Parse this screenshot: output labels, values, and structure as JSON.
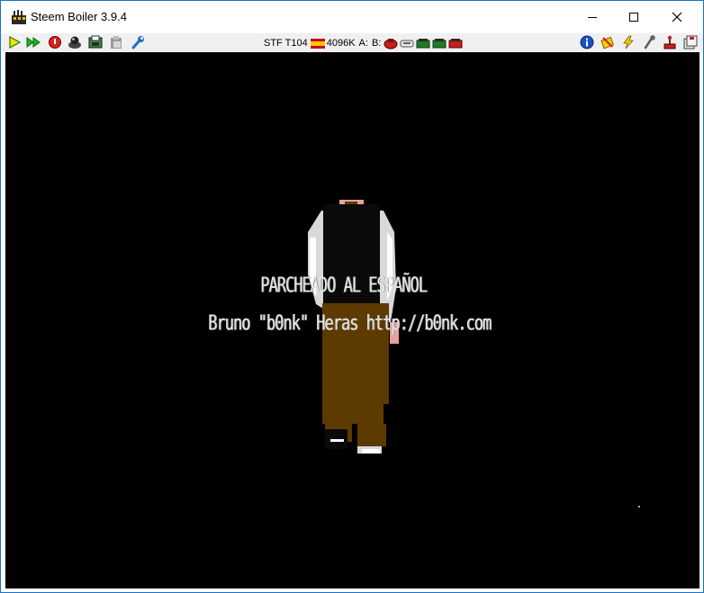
{
  "window": {
    "title": "Steem Boiler 3.9.4",
    "controls": {
      "minimize": "minimize-icon",
      "maximize": "maximize-icon",
      "close": "close-icon"
    }
  },
  "toolbar": {
    "left_icons": [
      "play-icon",
      "fast-forward-icon",
      "reset-icon",
      "joystick-icon",
      "memory-snapshot-icon",
      "paste-icon",
      "options-wrench-icon"
    ],
    "status_text": "STF T104",
    "memory": "4096K",
    "drive_a_label": "A:",
    "drive_b_label": "B:",
    "right_icons": [
      "info-icon",
      "patches-icon",
      "shortcuts-icon",
      "tools-icon",
      "joystick-config-icon",
      "disk-manager-icon"
    ]
  },
  "screen": {
    "caption_line1": "PARCHEADO AL ESPAÑOL",
    "caption_line2": "Bruno \"b0nk\" Heras http://b0nk.com"
  },
  "colors": {
    "window_border": "#1a73c8",
    "toolbar_bg": "#f0f0f0",
    "emulator_bg": "#000000",
    "coat": "#5c3a00",
    "shirt": "#d9d9d9"
  }
}
